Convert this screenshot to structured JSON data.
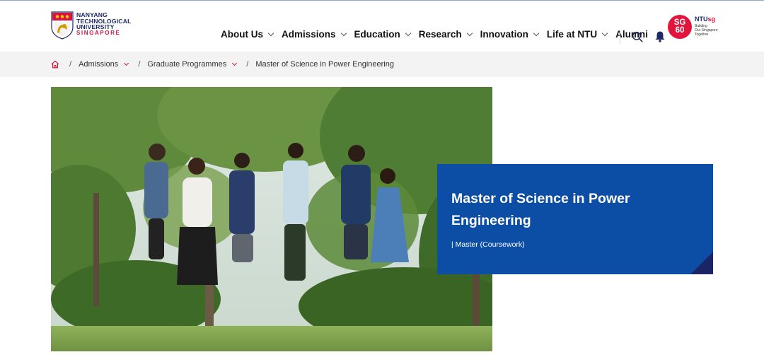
{
  "header": {
    "logo": {
      "line1": "NANYANG",
      "line2": "TECHNOLOGICAL",
      "line3": "UNIVERSITY",
      "line4": "SINGAPORE"
    },
    "nav": [
      {
        "label": "About Us",
        "has_dropdown": true
      },
      {
        "label": "Admissions",
        "has_dropdown": true
      },
      {
        "label": "Education",
        "has_dropdown": true
      },
      {
        "label": "Research",
        "has_dropdown": true
      },
      {
        "label": "Innovation",
        "has_dropdown": true
      },
      {
        "label": "Life at NTU",
        "has_dropdown": true
      },
      {
        "label": "Alumni",
        "has_dropdown": false
      }
    ],
    "sg60": {
      "badge_line1": "SG",
      "badge_line2": "60",
      "brand_prefix": "NTU",
      "brand_suffix": "sg",
      "tag1": "Building",
      "tag2": "Our Singapore",
      "tag3": "Together"
    }
  },
  "breadcrumb": {
    "items": [
      {
        "label": "Admissions"
      },
      {
        "label": "Graduate Programmes"
      }
    ],
    "current": "Master of Science in Power Engineering"
  },
  "hero": {
    "title": "Master of Science in Power Engineering",
    "meta": "| Master (Coursework)"
  },
  "colors": {
    "brand_blue": "#0c4ea6",
    "brand_red": "#d71440",
    "fold_navy": "#1b2566",
    "sg60_red": "#e2143c"
  },
  "icons": [
    "home-icon",
    "search-icon",
    "bell-icon",
    "chevron-down-icon",
    "crest-icon"
  ]
}
